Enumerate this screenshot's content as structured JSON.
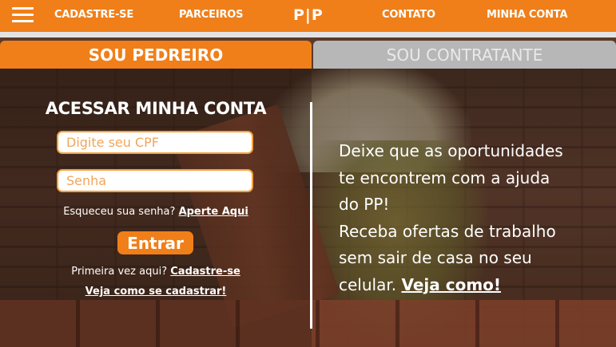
{
  "nav": {
    "menu_icon": "hamburger-menu-icon",
    "cadastre": "CADASTRE-SE",
    "parceiros": "PARCEIROS",
    "logo": "P|P",
    "contato": "CONTATO",
    "minha_conta": "MINHA CONTA"
  },
  "tabs": {
    "active": "SOU PEDREIRO",
    "inactive": "SOU CONTRATANTE"
  },
  "login": {
    "title": "ACESSAR MINHA CONTA",
    "cpf_placeholder": "Digite seu CPF",
    "password_placeholder": "Senha",
    "forgot_prefix": "Esqueceu sua senha?",
    "forgot_link": "Aperte Aqui",
    "enter_button": "Entrar",
    "first_time_prefix": "Primeira vez aqui?",
    "first_time_link": "Cadastre-se",
    "how_to_link": "Veja como se cadastrar!"
  },
  "message": {
    "line1": "Deixe que as oportunidades",
    "line2": "te encontrem com a ajuda",
    "line3": "do PP!",
    "line4": "Receba ofertas de trabalho",
    "line5": "sem sair de casa no seu",
    "line6_prefix": "celular.",
    "line6_link": "Veja como!"
  },
  "colors": {
    "brand_orange": "#f07f19",
    "tab_inactive_gray": "#b7b7b7",
    "field_border": "#f5a13c"
  }
}
